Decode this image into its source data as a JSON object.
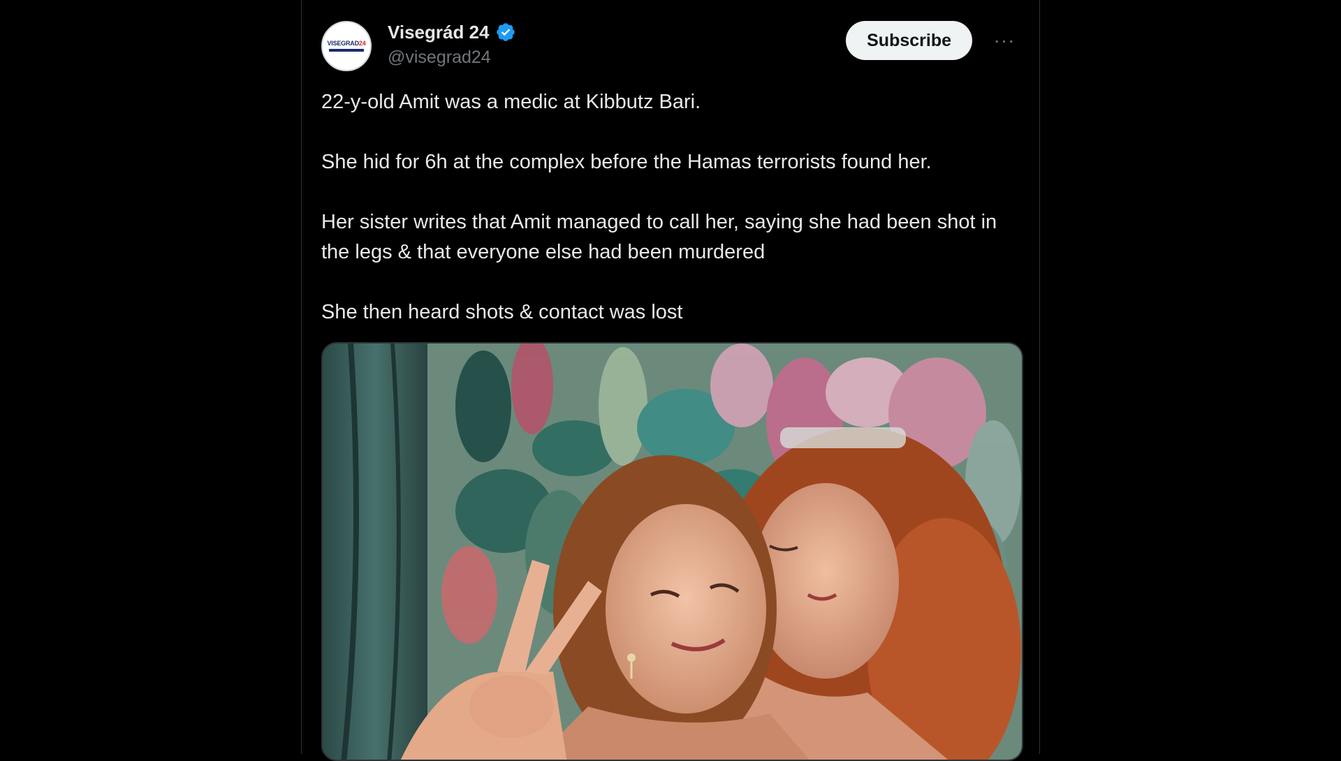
{
  "tweet": {
    "avatar": {
      "text_main": "VISEGRAD",
      "text_accent": "24"
    },
    "display_name": "Visegrád 24",
    "handle": "@visegrad24",
    "verified": true,
    "subscribe_label": "Subscribe",
    "more_label": "···",
    "paragraphs": [
      "22-y-old Amit was a medic at Kibbutz Bari.",
      "She hid for 6h at the complex before the Hamas terrorists found her.",
      "Her sister writes that Amit managed to call her, saying she had been shot in the legs & that everyone else had been murdered",
      "She then heard shots & contact was lost"
    ],
    "media": {
      "description_icon": "photo-image"
    }
  },
  "colors": {
    "background": "#000000",
    "text": "#e7e9ea",
    "secondary_text": "#71767b",
    "verified_blue": "#1d9bf0",
    "button_bg": "#eff3f4"
  }
}
